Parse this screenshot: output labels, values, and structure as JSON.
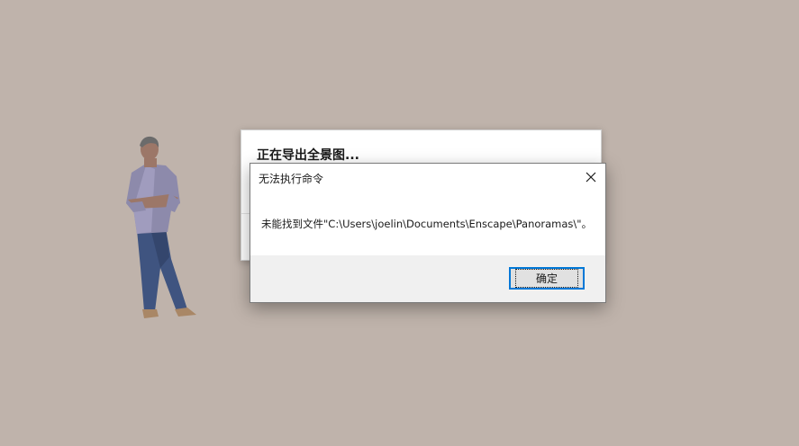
{
  "background_window": {
    "title": "正在导出全景图..."
  },
  "message_box": {
    "title": "无法执行命令",
    "message": "未能找到文件\"C:\\Users\\joelin\\Documents\\Enscape\\Panoramas\\\"。",
    "ok_label": "确定",
    "close_icon": "close-icon",
    "accent_color": "#0078d7"
  },
  "viewport": {
    "background_color": "#bfb3ab",
    "entourage": "person-figure"
  }
}
